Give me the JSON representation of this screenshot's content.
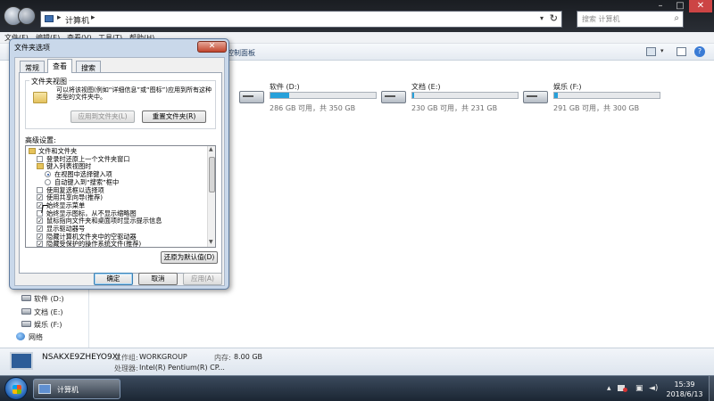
{
  "explorer": {
    "address_crumb": "计算机",
    "search_placeholder": "搜索 计算机",
    "menu": [
      "文件(F)",
      "编辑(E)",
      "查看(V)",
      "工具(T)",
      "帮助(H)"
    ],
    "toolbar_fragment": "控制面板",
    "nav": {
      "drive_d": "软件 (D:)",
      "drive_e": "文档 (E:)",
      "drive_f": "娱乐 (F:)",
      "network": "网络"
    },
    "drives": [
      {
        "name": "软件 (D:)",
        "free": "286 GB 可用，共 350 GB",
        "used_fraction": 0.18
      },
      {
        "name": "文档 (E:)",
        "free": "230 GB 可用，共 231 GB",
        "used_fraction": 0.01
      },
      {
        "name": "娱乐 (F:)",
        "free": "291 GB 可用，共 300 GB",
        "used_fraction": 0.03
      }
    ],
    "details": {
      "computer_name": "NSAKXE9ZHEYO9XI",
      "workgroup_label": "工作组:",
      "workgroup_value": "WORKGROUP",
      "memory_label": "内存:",
      "memory_value": "8.00 GB",
      "cpu_label": "处理器:",
      "cpu_value": "Intel(R) Pentium(R) CP..."
    }
  },
  "dialog": {
    "title": "文件夹选项",
    "close_glyph": "✕",
    "tabs": [
      "常规",
      "查看",
      "搜索"
    ],
    "active_tab": "查看",
    "folder_view": {
      "group_title": "文件夹视图",
      "description": "可以将该视图(例如“详细信息”或“图标”)应用到所有这种类型的文件夹中。",
      "apply_button": "应用到文件夹(L)",
      "reset_button": "重置文件夹(R)"
    },
    "advanced_label": "高级设置:",
    "tree_rows": [
      {
        "type": "folder",
        "indent": 0,
        "label": "文件和文件夹"
      },
      {
        "type": "checkbox",
        "indent": 1,
        "checked": false,
        "label": "登录时还原上一个文件夹窗口"
      },
      {
        "type": "folder",
        "indent": 1,
        "label": "键入列表视图时"
      },
      {
        "type": "radio",
        "indent": 2,
        "checked": true,
        "label": "在视图中选择键入项"
      },
      {
        "type": "radio",
        "indent": 2,
        "checked": false,
        "label": "自动键入到“搜索”框中"
      },
      {
        "type": "checkbox",
        "indent": 1,
        "checked": false,
        "label": "使用复选框以选择项"
      },
      {
        "type": "checkbox",
        "indent": 1,
        "checked": true,
        "label": "使用共享向导(推荐)"
      },
      {
        "type": "checkbox",
        "indent": 1,
        "checked": true,
        "label": "始终显示菜单"
      },
      {
        "type": "checkbox",
        "indent": 1,
        "checked": false,
        "label": "始终显示图标，从不显示缩略图"
      },
      {
        "type": "checkbox",
        "indent": 1,
        "checked": true,
        "label": "鼠标指向文件夹和桌面项时显示提示信息"
      },
      {
        "type": "checkbox",
        "indent": 1,
        "checked": true,
        "label": "显示驱动器号"
      },
      {
        "type": "checkbox",
        "indent": 1,
        "checked": true,
        "label": "隐藏计算机文件夹中的空驱动器"
      },
      {
        "type": "checkbox",
        "indent": 1,
        "checked": true,
        "label": "隐藏受保护的操作系统文件(推荐)"
      }
    ],
    "restore_defaults_button": "还原为默认值(D)",
    "ok_button": "确定",
    "cancel_button": "取消",
    "apply_button": "应用(A)"
  },
  "taskbar": {
    "task_label": "计算机",
    "time": "15:39",
    "date": "2018/6/13"
  },
  "icons": {
    "back": "back-arrow-icon",
    "forward": "forward-arrow-icon",
    "search": "search-icon",
    "refresh": "refresh-icon",
    "help": "help-icon"
  },
  "colors": {
    "drive_bar": "#26a0da",
    "dialog_frame": "#c9d8ea",
    "close_red": "#c2462d"
  }
}
